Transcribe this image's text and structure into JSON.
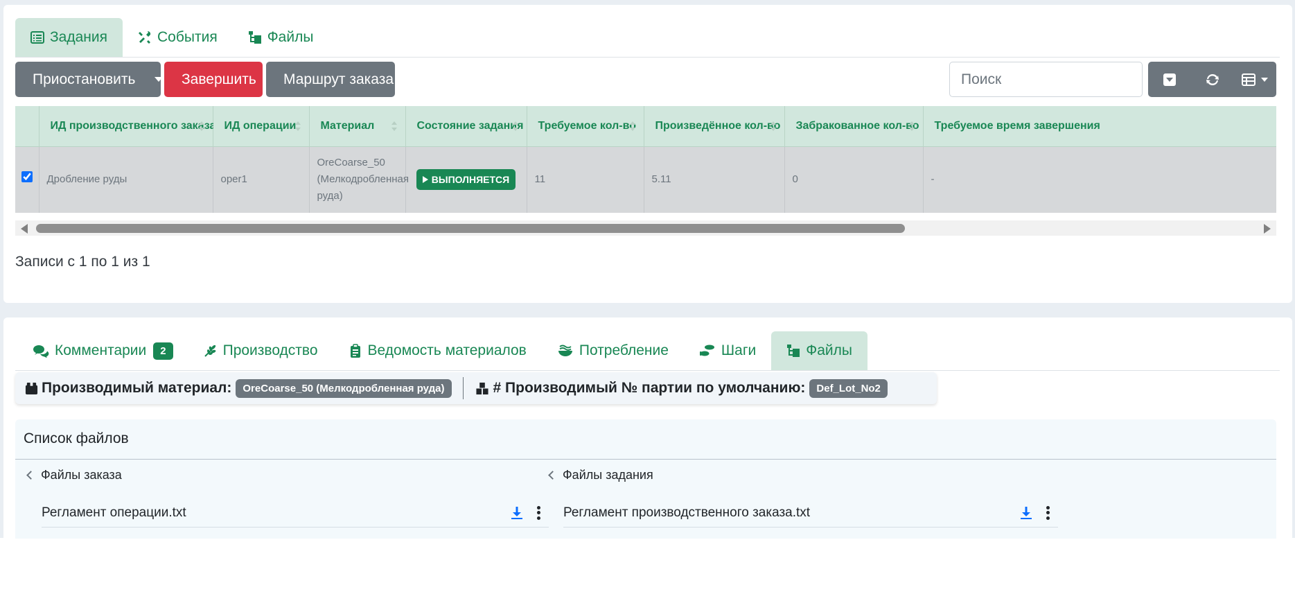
{
  "top_tabs": [
    "Задания",
    "События",
    "Файлы"
  ],
  "toolbar": {
    "pause_label": "Приостановить",
    "finish_label": "Завершить",
    "route_label": "Маршрут заказа",
    "search_placeholder": "Поиск"
  },
  "table": {
    "columns": [
      "ИД производственного заказа",
      "ИД операции",
      "Материал",
      "Состояние задания",
      "Требуемое кол-во",
      "Произведённое кол-во",
      "Забракованное кол-во",
      "Требуемое время завершения"
    ],
    "row": {
      "checked": true,
      "order_id": "Дробление руды",
      "operation_id": "oper1",
      "material": "OreCoarse_50 (Мелкодробленная руда)",
      "status": "ВЫПОЛНЯЕТСЯ",
      "required_qty": "11",
      "produced_qty": "5.11",
      "rejected_qty": "0",
      "required_time": "-"
    }
  },
  "records_text": "Записи с 1 по 1 из 1",
  "bottom_tabs": {
    "comments": "Комментарии",
    "comments_count": "2",
    "production": "Производство",
    "bom": "Ведомость материалов",
    "consumption": "Потребление",
    "steps": "Шаги",
    "files": "Файлы"
  },
  "info": {
    "material_label": "Производимый материал:",
    "material_value": "OreCoarse_50 (Мелкодробленная руда)",
    "lot_label": "# Производимый № партии по умолчанию:",
    "lot_value": "Def_Lot_No2"
  },
  "files": {
    "title": "Список файлов",
    "order_files_title": "Файлы заказа",
    "order_files": [
      "Регламент операции.txt"
    ],
    "task_files_title": "Файлы задания",
    "task_files": [
      "Регламент производственного заказа.txt"
    ]
  },
  "colors": {
    "accent": "#198754",
    "accent_light": "#d1e7dd",
    "danger": "#dc3545",
    "secondary": "#6c757d",
    "download": "#0d6efd"
  }
}
